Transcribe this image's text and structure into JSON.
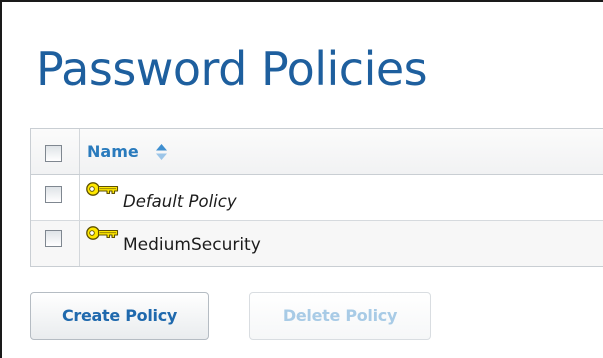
{
  "page": {
    "title": "Password Policies"
  },
  "table": {
    "columns": [
      {
        "label": "Name",
        "sortable": true
      }
    ],
    "rows": [
      {
        "name": "Default Policy",
        "icon": "key-icon",
        "italic": true,
        "checked": false
      },
      {
        "name": "MediumSecurity",
        "icon": "key-icon",
        "italic": false,
        "checked": false
      }
    ]
  },
  "actions": {
    "create_label": "Create Policy",
    "delete_label": "Delete Policy",
    "delete_disabled": true
  },
  "colors": {
    "title": "#1e5f9e",
    "header_link": "#2a7bbd",
    "button_text": "#1f69ad",
    "disabled_text": "#a8cbe6",
    "key_icon": "#e0c400"
  }
}
